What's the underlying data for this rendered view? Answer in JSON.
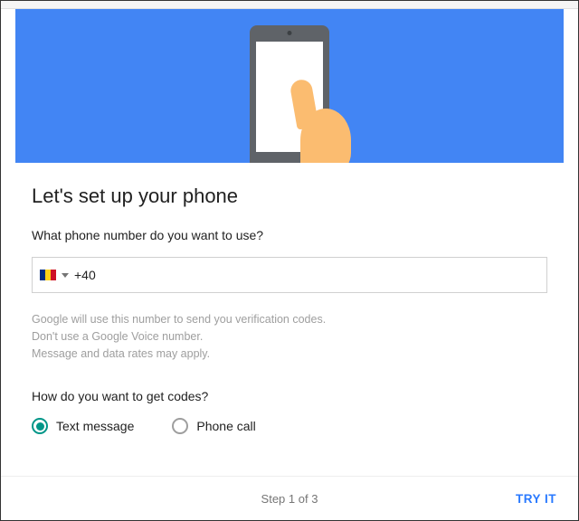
{
  "header": {
    "title": "Let's set up your phone"
  },
  "question_phone": "What phone number do you want to use?",
  "phone_input": {
    "country_flag": "romania",
    "dial_code": "+40",
    "value": ""
  },
  "hint": {
    "line1": "Google will use this number to send you verification codes.",
    "line2": "Don't use a Google Voice number.",
    "line3": "Message and data rates may apply."
  },
  "question_codes": "How do you want to get codes?",
  "radio": {
    "text_message": "Text message",
    "phone_call": "Phone call",
    "selected": "text_message"
  },
  "footer": {
    "step": "Step 1 of 3",
    "try_it": "TRY IT"
  }
}
